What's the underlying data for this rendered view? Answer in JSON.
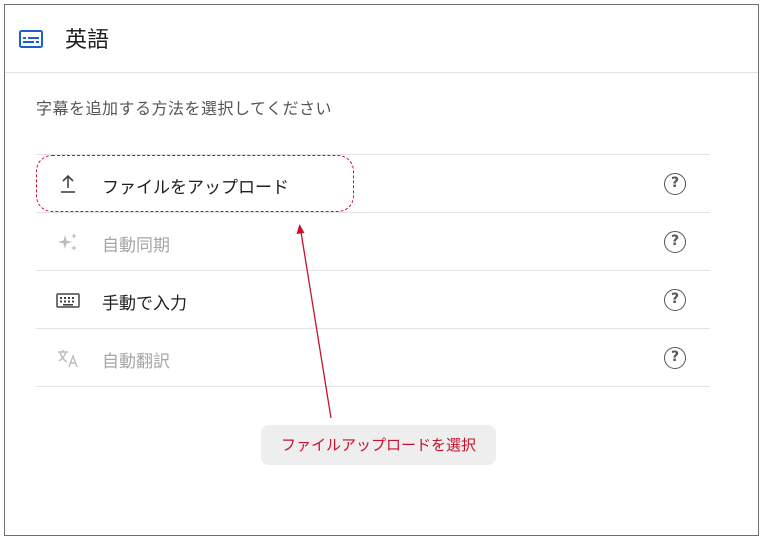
{
  "header": {
    "title": "英語",
    "icon": "subtitles-icon"
  },
  "instruction": "字幕を追加する方法を選択してください",
  "options": [
    {
      "label": "ファイルをアップロード",
      "icon": "upload-icon",
      "enabled": true,
      "help": "?"
    },
    {
      "label": "自動同期",
      "icon": "sparkle-icon",
      "enabled": false,
      "help": "?"
    },
    {
      "label": "手動で入力",
      "icon": "keyboard-icon",
      "enabled": true,
      "help": "?"
    },
    {
      "label": "自動翻訳",
      "icon": "translate-icon",
      "enabled": false,
      "help": "?"
    }
  ],
  "annotation": {
    "text": "ファイルアップロードを選択",
    "color": "#c8102e"
  },
  "colors": {
    "accent": "#1a5fd0",
    "annotation": "#c8102e",
    "disabled": "#a6a6a6"
  }
}
